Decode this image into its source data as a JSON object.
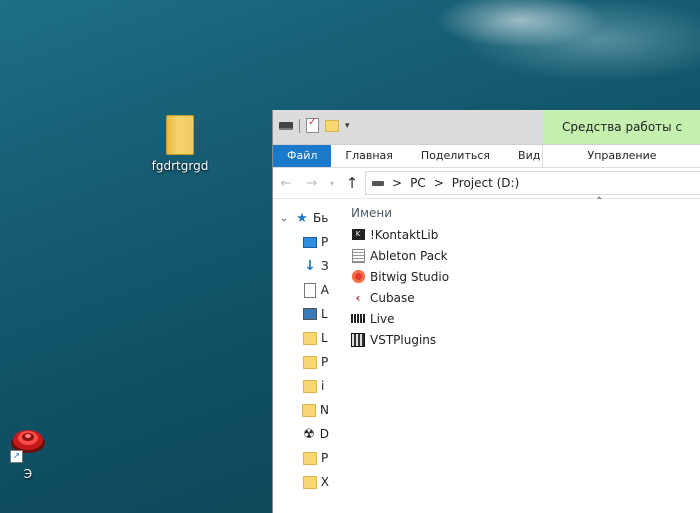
{
  "desktop": {
    "icons": [
      {
        "label": "fgdrtgrgd"
      },
      {
        "label": "Э"
      }
    ]
  },
  "explorer": {
    "context_tab": "Средства работы с дисками",
    "ribbon_tabs": {
      "file": "Файл",
      "home": "Главная",
      "share": "Поделиться",
      "view": "Вид",
      "manage": "Управление"
    },
    "address": {
      "crumbs": [
        "PC",
        "Project (D:)"
      ],
      "separator": ">"
    },
    "column_header": "Имени",
    "nav_items": [
      {
        "label": "Бь",
        "icon": "star-icon"
      },
      {
        "label": "Р",
        "icon": "desktop-icon"
      },
      {
        "label": "З",
        "icon": "download-arrow-icon"
      },
      {
        "label": "А",
        "icon": "document-icon"
      },
      {
        "label": "L",
        "icon": "pictures-icon"
      },
      {
        "label": "L",
        "icon": "folder-icon"
      },
      {
        "label": "Р",
        "icon": "folder-icon"
      },
      {
        "label": "i",
        "icon": "folder-icon"
      },
      {
        "label": "N",
        "icon": "folder-icon"
      },
      {
        "label": "D",
        "icon": "radiation-icon"
      },
      {
        "label": "Р",
        "icon": "folder-icon"
      },
      {
        "label": "Х",
        "icon": "folder-icon"
      }
    ],
    "files": [
      {
        "name": "!KontaktLib",
        "icon": "kontakt-icon"
      },
      {
        "name": "Ableton Pack",
        "icon": "ableton-pack-icon"
      },
      {
        "name": "Bitwig Studio",
        "icon": "bitwig-icon"
      },
      {
        "name": "Cubase",
        "icon": "cubase-icon"
      },
      {
        "name": "Live",
        "icon": "ableton-live-icon"
      },
      {
        "name": "VSTPlugins",
        "icon": "vst-plugins-icon"
      }
    ]
  }
}
